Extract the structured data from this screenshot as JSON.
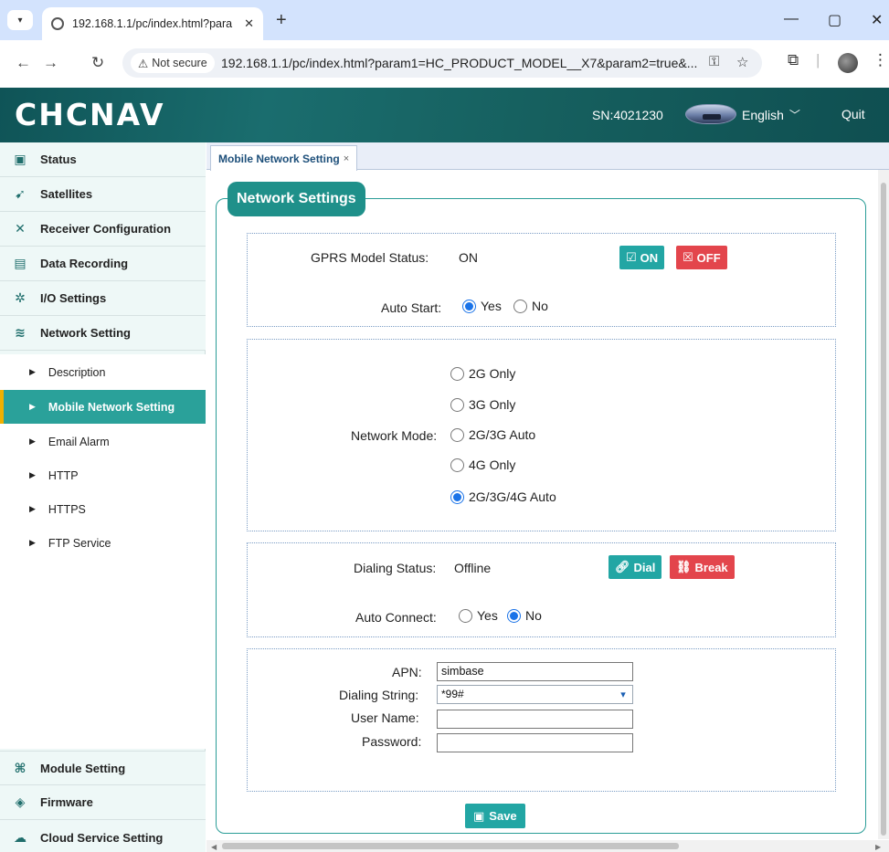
{
  "browser": {
    "tab_title": "192.168.1.1/pc/index.html?para",
    "tab_close": "✕",
    "new_tab": "+",
    "security": "Not secure",
    "url": "192.168.1.1/pc/index.html?param1=HC_PRODUCT_MODEL__X7&param2=true&..."
  },
  "header": {
    "logo": "CHCNAV",
    "serial": "SN:4021230",
    "language": "English",
    "quit": "Quit"
  },
  "sidebar": {
    "items": [
      {
        "label": "Status",
        "icon": "monitor-icon"
      },
      {
        "label": "Satellites",
        "icon": "satellite-icon"
      },
      {
        "label": "Receiver Configuration",
        "icon": "tools-icon"
      },
      {
        "label": "Data Recording",
        "icon": "list-icon"
      },
      {
        "label": "I/O Settings",
        "icon": "gear-icon"
      },
      {
        "label": "Network Setting",
        "icon": "wifi-icon"
      }
    ],
    "subitems": [
      {
        "label": "Description"
      },
      {
        "label": "Mobile Network Setting",
        "active": true
      },
      {
        "label": "Email Alarm"
      },
      {
        "label": "HTTP"
      },
      {
        "label": "HTTPS"
      },
      {
        "label": "FTP Service"
      }
    ],
    "bottom_items": [
      {
        "label": "Module Setting",
        "icon": "modules-icon"
      },
      {
        "label": "Firmware",
        "icon": "layers-icon"
      },
      {
        "label": "Cloud Service Setting",
        "icon": "cloud-icon"
      }
    ]
  },
  "content": {
    "tab_label": "Mobile Network Setting",
    "tab_close": "×",
    "panel_title": "Network Settings",
    "gprs": {
      "label": "GPRS Model Status:",
      "value": "ON",
      "on_button": "ON",
      "off_button": "OFF",
      "auto_start_label": "Auto Start:",
      "yes": "Yes",
      "no": "No",
      "auto_start_selected": "Yes"
    },
    "network_mode": {
      "label": "Network Mode:",
      "options": [
        "2G Only",
        "3G Only",
        "2G/3G Auto",
        "4G Only",
        "2G/3G/4G Auto"
      ],
      "selected": "2G/3G/4G Auto"
    },
    "dialing": {
      "label": "Dialing Status:",
      "value": "Offline",
      "dial_button": "Dial",
      "break_button": "Break",
      "auto_connect_label": "Auto Connect:",
      "yes": "Yes",
      "no": "No",
      "auto_connect_selected": "No"
    },
    "apn": {
      "apn_label": "APN:",
      "apn_value": "simbase",
      "dialing_string_label": "Dialing String:",
      "dialing_string_value": "*99#",
      "user_name_label": "User Name:",
      "user_name_value": "",
      "password_label": "Password:",
      "password_value": ""
    },
    "save_button": "Save"
  },
  "colors": {
    "accent": "#22a6a4",
    "danger": "#e3454c",
    "header_bg": "#16605f",
    "active_marker": "#f0b000"
  }
}
